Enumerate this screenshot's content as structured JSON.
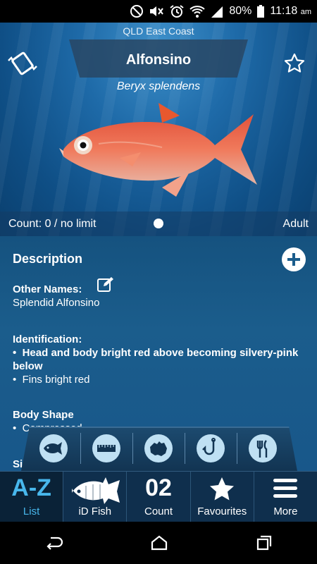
{
  "status": {
    "battery": "80%",
    "time": "11:18",
    "ampm": "am"
  },
  "header": {
    "region": "QLD East Coast",
    "name": "Alfonsino",
    "scientific": "Beryx splendens"
  },
  "count": {
    "label": "Count: 0 / no limit",
    "stage": "Adult"
  },
  "description": {
    "title": "Description",
    "other_names_h": "Other Names:",
    "other_names": "Splendid Alfonsino",
    "identification_h": "Identification:",
    "ident_1": "Head and body bright red above becoming silvery-pink below",
    "ident_2": "Fins bright red",
    "body_shape_h": "Body Shape",
    "body_shape_1": "Compressed",
    "partial_heading": "Si"
  },
  "tools": [
    "fish-icon",
    "ruler-icon",
    "australia-map-icon",
    "hook-icon",
    "cutlery-icon"
  ],
  "tabs": [
    {
      "big": "A-Z",
      "label": "List"
    },
    {
      "big": "",
      "label": "iD Fish"
    },
    {
      "big": "02",
      "label": "Count"
    },
    {
      "big": "",
      "label": "Favourites"
    },
    {
      "big": "",
      "label": "More"
    }
  ],
  "colors": {
    "accent": "#48b7ec",
    "panel": "#1b5d8c",
    "tabbar": "#0f2f4d"
  }
}
